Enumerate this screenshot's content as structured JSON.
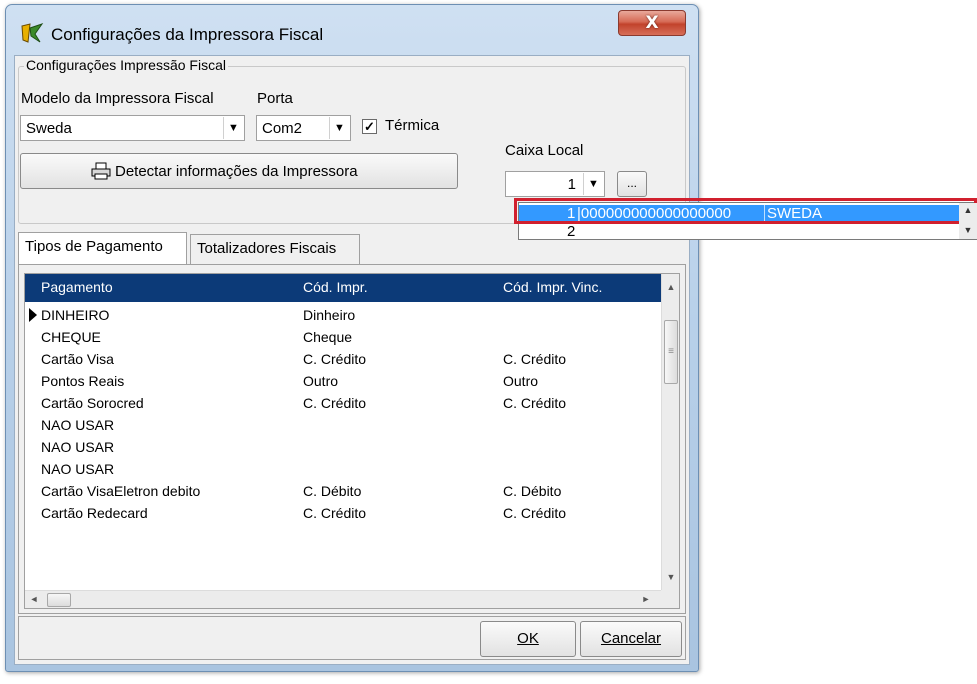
{
  "window": {
    "title": "Configurações da Impressora Fiscal",
    "close_label": "X"
  },
  "group": {
    "legend": "Configurações Impressão Fiscal",
    "modelo_label": "Modelo da Impressora Fiscal",
    "modelo_value": "Sweda",
    "porta_label": "Porta",
    "porta_value": "Com2",
    "termica_label": "Térmica",
    "termica_checked": true,
    "caixa_label": "Caixa Local",
    "caixa_value": "1",
    "browse_label": "...",
    "detect_button": "Detectar informações da Impressora"
  },
  "dropdown": {
    "items": [
      {
        "number": "1",
        "serial": "|000000000000000000",
        "name": "SWEDA"
      },
      {
        "number": "2",
        "serial": "",
        "name": ""
      }
    ]
  },
  "tabs": [
    {
      "label": "Tipos de Pagamento",
      "active": true
    },
    {
      "label": "Totalizadores Fiscais",
      "active": false
    }
  ],
  "grid": {
    "columns": [
      "Pagamento",
      "Cód. Impr.",
      "Cód. Impr. Vinc."
    ],
    "rows": [
      [
        "DINHEIRO",
        "Dinheiro",
        ""
      ],
      [
        "CHEQUE",
        "Cheque",
        ""
      ],
      [
        "Cartão Visa",
        "C. Crédito",
        "C. Crédito"
      ],
      [
        "Pontos Reais",
        "Outro",
        "Outro"
      ],
      [
        "Cartão Sorocred",
        "C. Crédito",
        "C. Crédito"
      ],
      [
        "NAO USAR",
        "",
        ""
      ],
      [
        "NAO USAR",
        "",
        ""
      ],
      [
        "NAO USAR",
        "",
        ""
      ],
      [
        "Cartão VisaEletron debito",
        "C. Débito",
        "C. Débito"
      ],
      [
        "Cartão Redecard",
        "C. Crédito",
        "C. Crédito"
      ]
    ],
    "current_row": 0
  },
  "buttons": {
    "ok": "OK",
    "cancel": "Cancelar"
  },
  "colors": {
    "header_bg": "#0c3a78",
    "selection": "#3399ff",
    "highlight_box": "#d1202e"
  }
}
